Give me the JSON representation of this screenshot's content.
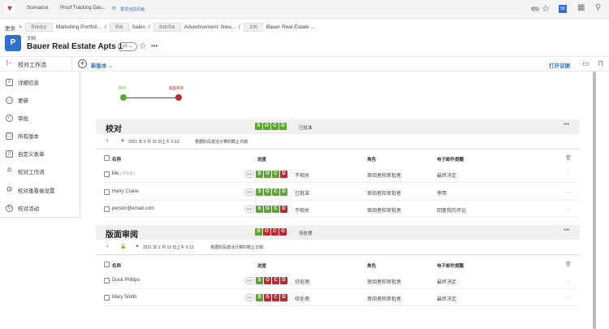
{
  "topbar": {
    "tabs": [
      "Scenarios",
      "Proof Tracking Das..."
    ],
    "pin_label": "置顶当前页面",
    "help": "帮助",
    "notif_count": "56"
  },
  "breadcrumb": {
    "more": "更多",
    "items": [
      {
        "tag": "项目组合",
        "label": "Marketing Portfoli..."
      },
      {
        "tag": "项目",
        "label": "Sales"
      },
      {
        "tag": "高级项目",
        "label": "Advertisement: New..."
      },
      {
        "tag": "文档",
        "label": "Bauer Real Estate ..."
      }
    ]
  },
  "doc": {
    "type": "文档",
    "title": "Bauer Real Estate Apts 1",
    "version": "v1"
  },
  "toolbar": {
    "back_label": "校对工作流",
    "new_version": "新版本",
    "open_proof": "打开证据"
  },
  "sidebar": {
    "items": [
      "详细信息",
      "更新",
      "审批",
      "所有版本",
      "自定义表单",
      "校对工作流",
      "校对查看者设置",
      "校对活动"
    ]
  },
  "timeline": {
    "stage1": "校对",
    "stage2": "版面审阅",
    "color1": "#5aa832",
    "color2": "#c8242b"
  },
  "columns": {
    "name": "名称",
    "progress": "进度",
    "role": "角色",
    "email": "电子邮件提醒"
  },
  "stages": [
    {
      "title": "校对",
      "status": "已批准",
      "date": "2021 年 2 月 15 日上午 0:13",
      "deadline": "根据阶段激活计算的截止日期",
      "rows": [
        {
          "name": "Me",
          "tag": "[ 所有者 ]",
          "status": "不相关",
          "role": "审阅者和审批者",
          "email": "最终决定",
          "oo": "0/0"
        },
        {
          "name": "Harry Crane",
          "status": "已批准",
          "role": "审阅者和审批者",
          "email": "停用",
          "oo": "0/0"
        },
        {
          "name": "person@email.com",
          "status": "不相关",
          "role": "审阅者和审批者",
          "email": "回复我的评论",
          "oo": "0/0"
        }
      ]
    },
    {
      "title": "版面审阅",
      "status": "待处理",
      "date": "2021 年 2 月 15 日上午 0:13",
      "deadline": "根据阶段激活计算的截止日期",
      "rows": [
        {
          "name": "Duck Phillips",
          "status": "待处理",
          "role": "审阅者和审批者",
          "email": "最终决定",
          "oo": "0/0"
        },
        {
          "name": "Mary Smith",
          "status": "待处理",
          "role": "审阅者和审批者",
          "email": "最终决定",
          "oo": "0/0"
        }
      ]
    }
  ],
  "socd": [
    "S",
    "O",
    "C",
    "D"
  ]
}
